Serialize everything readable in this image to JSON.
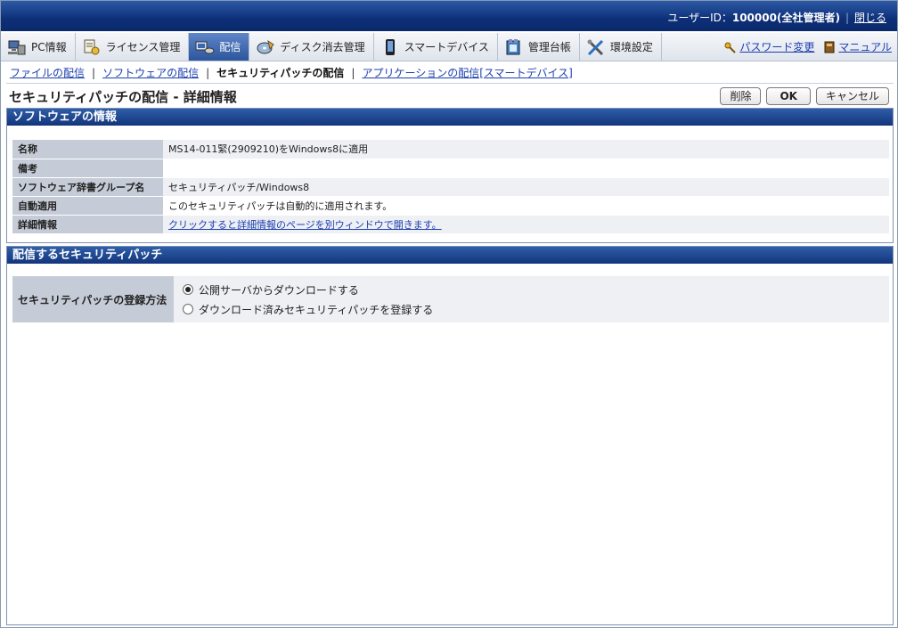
{
  "header": {
    "user_label": "ユーザーID：",
    "user_id": "100000(全社管理者)",
    "close_link": "閉じる"
  },
  "tabs": [
    {
      "label": "PC情報",
      "icon": "pc-icon",
      "active": false
    },
    {
      "label": "ライセンス管理",
      "icon": "license-icon",
      "active": false
    },
    {
      "label": "配信",
      "icon": "distribution-icon",
      "active": true
    },
    {
      "label": "ディスク消去管理",
      "icon": "disk-erase-icon",
      "active": false
    },
    {
      "label": "スマートデバイス",
      "icon": "smart-device-icon",
      "active": false
    },
    {
      "label": "管理台帳",
      "icon": "ledger-icon",
      "active": false
    },
    {
      "label": "環境設定",
      "icon": "settings-icon",
      "active": false
    }
  ],
  "tab_links": {
    "password": "パスワード変更",
    "manual": "マニュアル"
  },
  "subnav": {
    "file": "ファイルの配信",
    "software": "ソフトウェアの配信",
    "security": "セキュリティパッチの配信",
    "application": "アプリケーションの配信[スマートデバイス]"
  },
  "page": {
    "title": "セキュリティパッチの配信 - 詳細情報",
    "delete_button": "削除",
    "ok_button": "OK",
    "cancel_button": "キャンセル"
  },
  "software_info": {
    "heading": "ソフトウェアの情報",
    "rows": [
      {
        "key": "名称",
        "value": "MS14-011緊(2909210)をWindows8に適用"
      },
      {
        "key": "備考",
        "value": ""
      },
      {
        "key": "ソフトウェア辞書グループ名",
        "value": "セキュリティパッチ/Windows8"
      },
      {
        "key": "自動適用",
        "value": "このセキュリティパッチは自動的に適用されます。"
      },
      {
        "key": "詳細情報",
        "value": "クリックすると詳細情報のページを別ウィンドウで開きます。"
      }
    ]
  },
  "distribution": {
    "heading": "配信するセキュリティパッチ",
    "method_label": "セキュリティパッチの登録方法",
    "options": [
      {
        "label": "公開サーバからダウンロードする",
        "selected": true
      },
      {
        "label": "ダウンロード済みセキュリティパッチを登録する",
        "selected": false
      }
    ]
  },
  "colors": {
    "header_blue": "#0d2f78",
    "panel_head": "#12357c",
    "link": "#1c3fb0",
    "key_cell": "#c6ccd7"
  }
}
